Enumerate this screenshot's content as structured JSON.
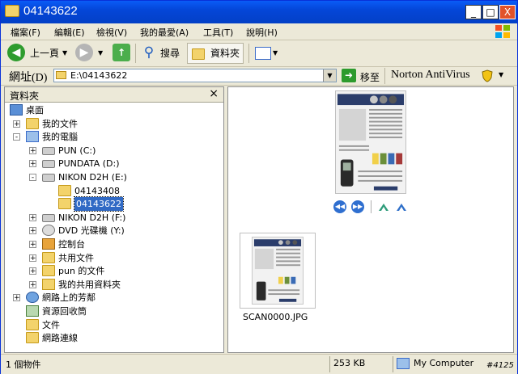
{
  "window": {
    "title": "04143622",
    "controls": {
      "minimize": "_",
      "maximize": "□",
      "close": "X"
    }
  },
  "menu": {
    "items": [
      "檔案(F)",
      "編輯(E)",
      "檢視(V)",
      "我的最愛(A)",
      "工具(T)",
      "說明(H)"
    ]
  },
  "toolbar": {
    "back_label": "上一頁",
    "search_label": "搜尋",
    "folders_label": "資料夾"
  },
  "address": {
    "label": "網址(D)",
    "value": "E:\\04143622",
    "go_label": "移至",
    "norton_label": "Norton AntiVirus"
  },
  "folders_panel": {
    "title": "資料夾",
    "close": "×",
    "tree": [
      {
        "label": "桌面",
        "level": 0,
        "expander": "",
        "icon": "desktop-icon"
      },
      {
        "label": "我的文件",
        "level": 1,
        "expander": "+",
        "icon": "folder-icon"
      },
      {
        "label": "我的電腦",
        "level": 1,
        "expander": "−",
        "icon": "computer-icon"
      },
      {
        "label": "PUN (C:)",
        "level": 2,
        "expander": "+",
        "icon": "drive-icon"
      },
      {
        "label": "PUNDATA (D:)",
        "level": 2,
        "expander": "+",
        "icon": "drive-icon"
      },
      {
        "label": "NIKON D2H (E:)",
        "level": 2,
        "expander": "−",
        "icon": "drive-icon"
      },
      {
        "label": "04143408",
        "level": 3,
        "expander": "",
        "icon": "folder-icon"
      },
      {
        "label": "04143622",
        "level": 3,
        "expander": "",
        "icon": "folder-icon",
        "selected": true
      },
      {
        "label": "NIKON D2H (F:)",
        "level": 2,
        "expander": "+",
        "icon": "drive-icon"
      },
      {
        "label": "DVD 光碟機 (Y:)",
        "level": 2,
        "expander": "+",
        "icon": "dvd-icon"
      },
      {
        "label": "控制台",
        "level": 2,
        "expander": "+",
        "icon": "control-panel-icon"
      },
      {
        "label": "共用文件",
        "level": 2,
        "expander": "+",
        "icon": "folder-icon"
      },
      {
        "label": "pun 的文件",
        "level": 2,
        "expander": "+",
        "icon": "folder-icon"
      },
      {
        "label": "我的共用資料夾",
        "level": 2,
        "expander": "+",
        "icon": "shared-folder-icon"
      },
      {
        "label": "網路上的芳鄰",
        "level": 1,
        "expander": "+",
        "icon": "network-icon"
      },
      {
        "label": "資源回收筒",
        "level": 1,
        "expander": "",
        "icon": "recycle-bin-icon"
      },
      {
        "label": "文件",
        "level": 1,
        "expander": "",
        "icon": "folder-icon"
      },
      {
        "label": "網路連線",
        "level": 1,
        "expander": "",
        "icon": "folder-icon"
      }
    ]
  },
  "content": {
    "file_name": "SCAN0000.JPG"
  },
  "status": {
    "items": "1 個物件",
    "size": "253 KB",
    "zone": "My Computer",
    "watermark": "#4125"
  }
}
